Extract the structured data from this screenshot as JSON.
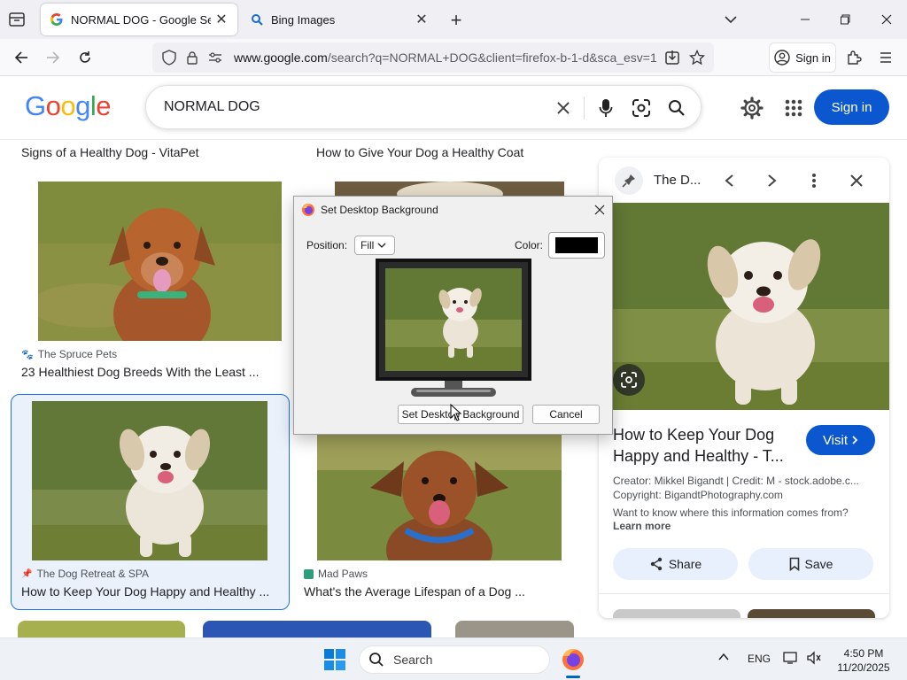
{
  "browser": {
    "tabs": [
      {
        "label": "NORMAL DOG - Google Search",
        "active": true
      },
      {
        "label": "Bing Images",
        "active": false
      }
    ],
    "url_domain": "www.google.com",
    "url_rest": "/search?q=NORMAL+DOG&client=firefox-b-1-d&sca_esv=1",
    "signin_label": "Sign in"
  },
  "google": {
    "logo": "Google",
    "query": "NORMAL DOG",
    "signin_label": "Sign in"
  },
  "results": {
    "row0": {
      "left_title": "Signs of a Healthy Dog - VitaPet",
      "right_title": "How to Give Your Dog a Healthy Coat"
    },
    "row1_left": {
      "source": "The Spruce Pets",
      "title": "23 Healthiest Dog Breeds With the Least ..."
    },
    "row2_left": {
      "source": "The Dog Retreat & SPA",
      "title": "How to Keep Your Dog Happy and Healthy ..."
    },
    "row2_right": {
      "source": "Mad Paws",
      "title": "What's the Average Lifespan of a Dog ..."
    }
  },
  "panel": {
    "source_short": "The D...",
    "title": "How to Keep Your Dog Happy and Healthy - T...",
    "visit_label": "Visit",
    "creator": "Creator: Mikkel Bigandt | Credit: M - stock.adobe.c...",
    "copyright": "Copyright: BigandtPhotography.com",
    "info_question": "Want to know where this information comes from?",
    "learn_more": "Learn more",
    "share_label": "Share",
    "save_label": "Save"
  },
  "dialog": {
    "title": "Set Desktop Background",
    "position_label": "Position:",
    "position_value": "Fill",
    "color_label": "Color:",
    "color_value": "#000000",
    "set_button": "Set Desktop Background",
    "cancel_button": "Cancel"
  },
  "taskbar": {
    "search_placeholder": "Search",
    "language": "ENG",
    "time": "4:50 PM",
    "date": "11/20/2025"
  },
  "colors": {
    "google_blue": "#0b57d0",
    "selection_border": "#1a73e8",
    "dialog_bg": "#f0f0f0"
  },
  "icons": [
    "list-all-tabs-icon",
    "google-favicon",
    "search-favicon",
    "close-icon",
    "plus-icon",
    "chevron-down-icon",
    "minimize-icon",
    "maximize-icon",
    "back-icon",
    "forward-icon",
    "reload-icon",
    "shield-icon",
    "lock-icon",
    "permissions-icon",
    "save-to-pocket-icon",
    "star-icon",
    "account-icon",
    "extensions-icon",
    "menu-icon",
    "clear-icon",
    "mic-icon",
    "lens-icon",
    "search-icon",
    "gear-icon",
    "apps-grid-icon",
    "paw-icon",
    "pin-icon",
    "chevron-left-icon",
    "chevron-right-icon",
    "more-vert-icon",
    "share-icon",
    "bookmark-icon",
    "firefox-icon",
    "windows-start-icon",
    "wifi-icon",
    "volume-icon"
  ]
}
